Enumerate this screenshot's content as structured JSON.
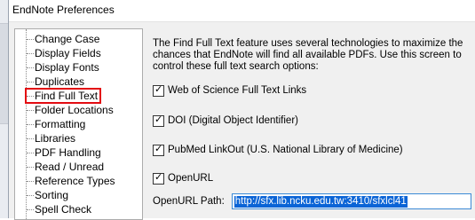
{
  "window": {
    "title": "EndNote Preferences"
  },
  "categories": [
    "Change Case",
    "Display Fields",
    "Display Fonts",
    "Duplicates",
    "Find Full Text",
    "Folder Locations",
    "Formatting",
    "Libraries",
    "PDF Handling",
    "Read / Unread",
    "Reference Types",
    "Sorting",
    "Spell Check"
  ],
  "selected_category": "Find Full Text",
  "panel": {
    "description": "The Find Full Text feature uses several technologies to maximize the chances that EndNote will find all available PDFs. Use this screen to control these full text search options:",
    "options": [
      {
        "label": "Web of Science Full Text Links",
        "checked": true
      },
      {
        "label": "DOI (Digital Object Identifier)",
        "checked": true
      },
      {
        "label": "PubMed LinkOut (U.S. National Library of Medicine)",
        "checked": true
      },
      {
        "label": "OpenURL",
        "checked": true
      }
    ],
    "openurl_path_label": "OpenURL Path:",
    "openurl_path_value": "http://sfx.lib.ncku.edu.tw:3410/sfxlcl41"
  },
  "icons": {
    "checkmark": "check-icon"
  }
}
